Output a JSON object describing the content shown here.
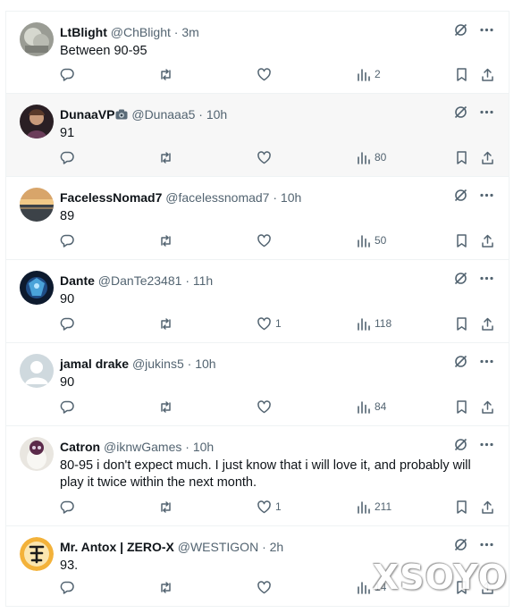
{
  "tweets": [
    {
      "name": "LtBlight",
      "handle": "@ChBlight",
      "time": "3m",
      "text": "Between 90-95",
      "likes": "",
      "views": "2",
      "hover": false,
      "avatar": "gray-rock"
    },
    {
      "name": "DunaaVP",
      "handle": "@Dunaaa5",
      "time": "10h",
      "text": "91",
      "likes": "",
      "views": "80",
      "hover": true,
      "avatar": "dark-figure"
    },
    {
      "name": "FacelessNomad7",
      "handle": "@facelessnomad7",
      "time": "10h",
      "text": "89",
      "likes": "",
      "views": "50",
      "hover": false,
      "avatar": "sunset"
    },
    {
      "name": "Dante",
      "handle": "@DanTe23481",
      "time": "11h",
      "text": "90",
      "likes": "1",
      "views": "118",
      "hover": false,
      "avatar": "blue-knight"
    },
    {
      "name": "jamal drake",
      "handle": "@jukins5",
      "time": "10h",
      "text": "90",
      "likes": "",
      "views": "84",
      "hover": false,
      "avatar": "default-user"
    },
    {
      "name": "Catron",
      "handle": "@iknwGames",
      "time": "10h",
      "text": "80-95 i don't expect much. I just know that i will love it, and probably will play it twice within the next month.",
      "likes": "1",
      "views": "211",
      "hover": false,
      "avatar": "white-creature"
    },
    {
      "name": "Mr. Antox | ZERO-X",
      "handle": "@WESTIGON",
      "time": "2h",
      "text": "93.",
      "likes": "",
      "views": "14",
      "hover": false,
      "avatar": "orange-kanji"
    }
  ],
  "separator": "·",
  "watermark": "XSOYO",
  "colors": {
    "text": "#0f1419",
    "muted": "#536471",
    "divider": "#eff3f4",
    "hover": "#f7f7f7"
  }
}
